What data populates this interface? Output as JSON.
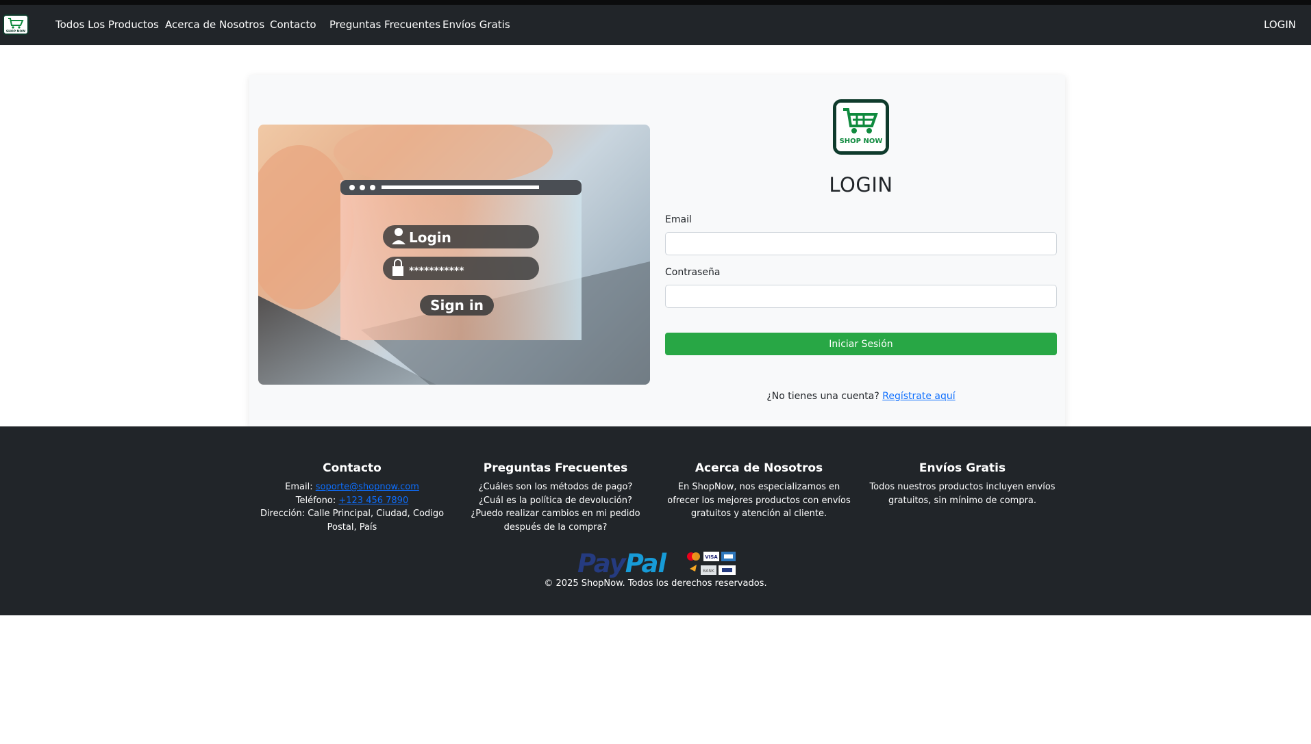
{
  "nav": {
    "logo_text": "SHOP NOW",
    "links": [
      "Todos Los Productos",
      "Acerca de Nosotros",
      "Contacto",
      "Preguntas Frecuentes",
      "Envíos Gratis"
    ],
    "login": "LOGIN"
  },
  "hero": {
    "login_text": "Login",
    "password_mask": "***********",
    "signin_text": "Sign in"
  },
  "form": {
    "logo_text": "SHOP NOW",
    "title": "LOGIN",
    "email_label": "Email",
    "email_value": "",
    "password_label": "Contraseña",
    "password_value": "",
    "submit_label": "Iniciar Sesión",
    "register_prompt": "¿No tienes una cuenta?",
    "register_link": "Regístrate aquí"
  },
  "footer": {
    "contact": {
      "title": "Contacto",
      "email_label": "Email:",
      "email": "soporte@shopnow.com",
      "phone_label": "Teléfono:",
      "phone": "+123 456 7890",
      "address": "Dirección: Calle Principal, Ciudad, Codigo Postal, País"
    },
    "faq": {
      "title": "Preguntas Frecuentes",
      "q1": "¿Cuáles son los métodos de pago?",
      "q2": "¿Cuál es la política de devolución?",
      "q3": "¿Puedo realizar cambios en mi pedido después de la compra?"
    },
    "about": {
      "title": "Acerca de Nosotros",
      "text": "En ShopNow, nos especializamos en ofrecer los mejores productos con envíos gratuitos y atención al cliente."
    },
    "shipping": {
      "title": "Envíos Gratis",
      "text": "Todos nuestros productos incluyen envíos gratuitos, sin mínimo de compra."
    },
    "paypal_a": "Pay",
    "paypal_b": "Pal",
    "card_visa": "VISA",
    "card_bank": "BANK",
    "copyright": "© 2025 ShopNow. Todos los derechos reservados."
  },
  "colors": {
    "navbar": "#212529",
    "primary_green": "#28a745",
    "link_blue": "#0d6efd",
    "logo_green": "#0f8a3e"
  }
}
